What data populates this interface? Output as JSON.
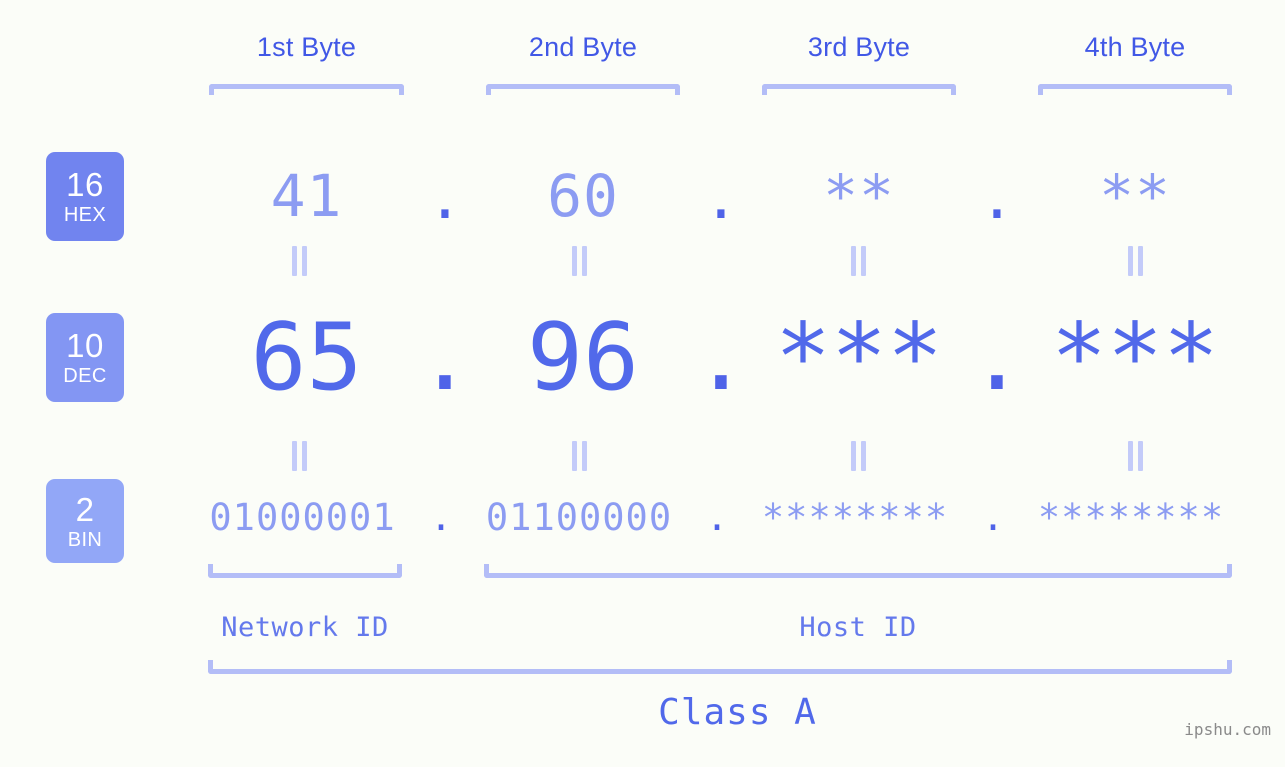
{
  "meta": {
    "watermark": "ipshu.com",
    "background_color": "#fbfdf8",
    "accent_strong": "#4158e6",
    "accent_mid": "#5169ea",
    "accent_light": "#8c9cf2",
    "bracket_color": "#b3bdf7"
  },
  "byte_headers": [
    {
      "label": "1st Byte"
    },
    {
      "label": "2nd Byte"
    },
    {
      "label": "3rd Byte"
    },
    {
      "label": "4th Byte"
    }
  ],
  "bases": [
    {
      "id": "hex",
      "number": "16",
      "abbr": "HEX",
      "color": "#7184ef"
    },
    {
      "id": "dec",
      "number": "10",
      "abbr": "DEC",
      "color": "#8396f3"
    },
    {
      "id": "bin",
      "number": "2",
      "abbr": "BIN",
      "color": "#92a7f7"
    }
  ],
  "rows": {
    "hex": {
      "octets": [
        "41",
        "60",
        "**",
        "**"
      ],
      "separator": "."
    },
    "dec": {
      "octets": [
        "65",
        "96",
        "***",
        "***"
      ],
      "separator": "."
    },
    "bin": {
      "octets": [
        "01000001",
        "01100000",
        "********",
        "********"
      ],
      "separator": "."
    }
  },
  "connector": {
    "symbol": "="
  },
  "id_sections": [
    {
      "label": "Network ID"
    },
    {
      "label": "Host ID"
    }
  ],
  "class": {
    "label": "Class A"
  }
}
